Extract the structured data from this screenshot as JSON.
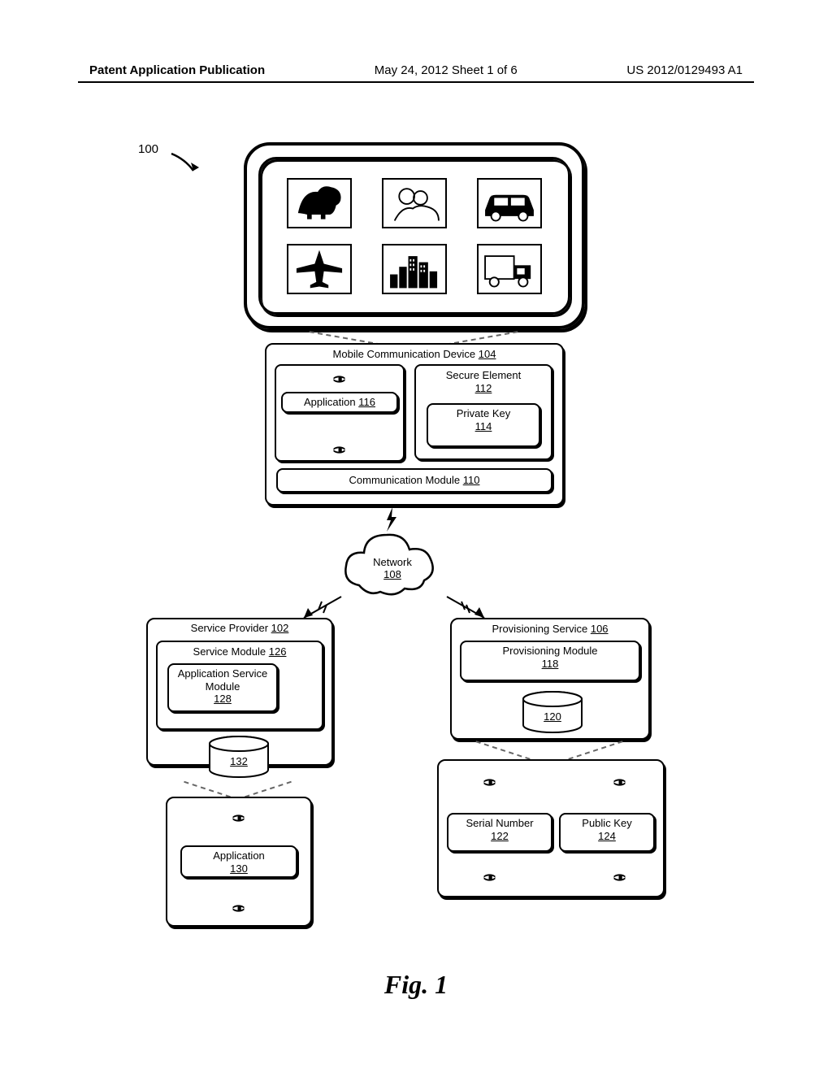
{
  "header": {
    "doc_type": "Patent Application Publication",
    "date_sheet": "May 24, 2012  Sheet 1 of 6",
    "pub_no": "US 2012/0129493 A1"
  },
  "refs": {
    "ref100": "100"
  },
  "mcd": {
    "title_prefix": "Mobile Communication Device ",
    "title_num": "104",
    "app_label_prefix": "Application ",
    "app_label_num": "116",
    "secure_element_label": "Secure Element",
    "secure_element_num": "112",
    "private_key_label": "Private Key",
    "private_key_num": "114",
    "comm_label_prefix": "Communication Module ",
    "comm_label_num": "110"
  },
  "network": {
    "label": "Network",
    "num": "108"
  },
  "service_provider": {
    "title_prefix": "Service Provider ",
    "title_num": "102",
    "service_module_prefix": "Service Module ",
    "service_module_num": "126",
    "asm_label": "Application Service Module",
    "asm_num": "128",
    "db_num": "132",
    "app_label": "Application",
    "app_num": "130"
  },
  "provisioning": {
    "title_prefix": "Provisioning Service ",
    "title_num": "106",
    "module_label": "Provisioning Module",
    "module_num": "118",
    "db_num": "120",
    "serial_label": "Serial Number",
    "serial_num": "122",
    "public_key_label": "Public Key",
    "public_key_num": "124"
  },
  "figure": {
    "label": "Fig. 1"
  }
}
